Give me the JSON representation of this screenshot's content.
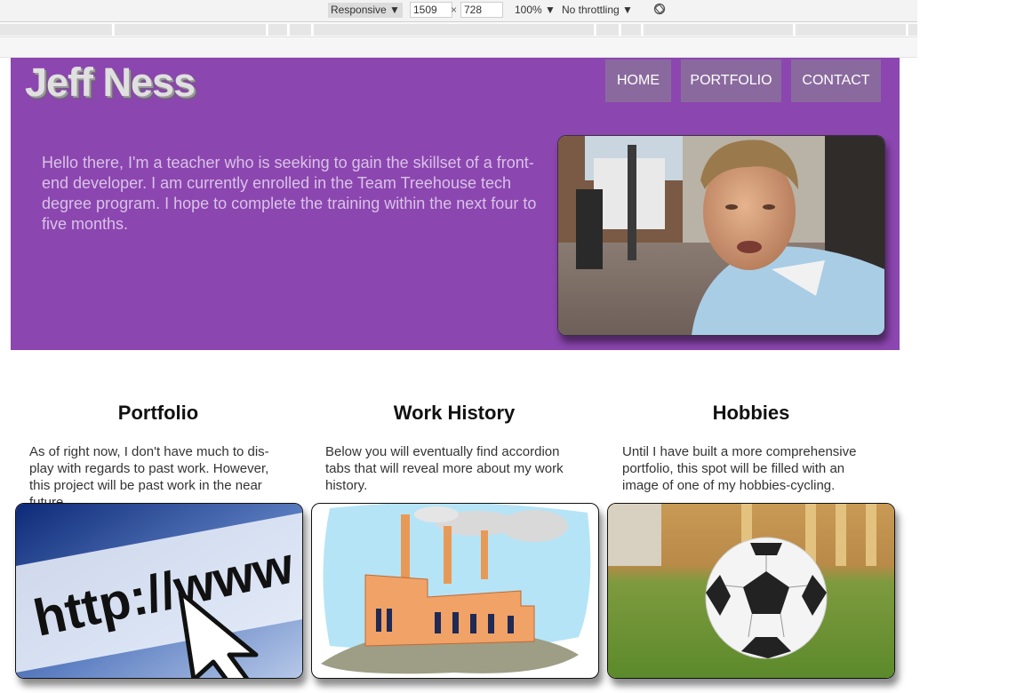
{
  "devtools": {
    "mode": "Responsive ▼",
    "width": "1509",
    "height": "728",
    "zoom": "100% ▼",
    "throttle": "No throttling ▼",
    "rotate_icon": "rotate-icon"
  },
  "header": {
    "logo": "Jeff Ness",
    "nav": {
      "home": "HOME",
      "portfolio": "PORTFOLIO",
      "contact": "CONTACT"
    }
  },
  "intro": {
    "text": "Hello there, I'm a teacher who is seeking to gain the skillset of a front-end developer. I am currently enrolled in the Team Treehouse tech degree program. I hope to complete the training within the next four to five months."
  },
  "columns": [
    {
      "title": "Portfolio",
      "text": "As of right now, I don't have much to dis-play with regards to past work. However, this project will be past work in the near future."
    },
    {
      "title": "Work History",
      "text": "Below you will eventually find accordion tabs that will reveal more about my work history."
    },
    {
      "title": "Hobbies",
      "text": "Until I have built a more comprehensive portfolio, this spot will be filled with an image of one of my hobbies-cycling."
    }
  ],
  "card_texts": {
    "url_image": "http://www"
  },
  "colors": {
    "hero": "#8c46b0",
    "nav": "#8a6a9e",
    "intro_text": "#d8c3e6"
  }
}
